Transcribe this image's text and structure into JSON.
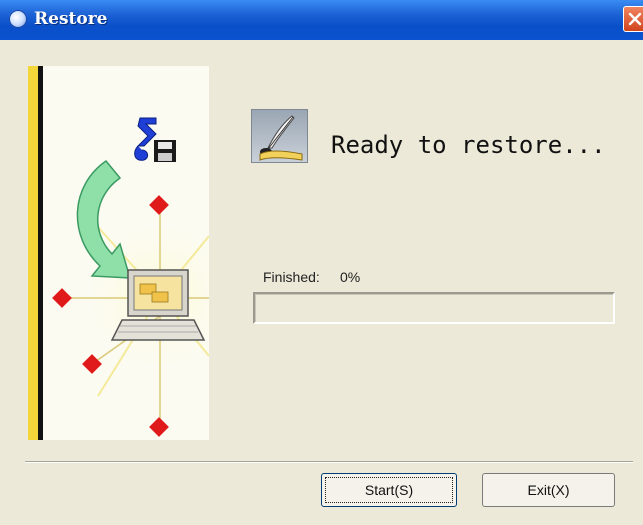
{
  "window": {
    "title": "Restore",
    "icon": "restore-app-icon",
    "close_icon": "close-icon"
  },
  "main": {
    "status_icon": "quill-scroll-icon",
    "status_text": "Ready to restore...",
    "progress": {
      "label": "Finished:",
      "value_text": "0%",
      "percent": 0
    }
  },
  "buttons": {
    "start_label": "Start(S)",
    "exit_label": "Exit(X)"
  },
  "colors": {
    "titlebar": "#0a4fc8",
    "window_bg": "#ece9d8",
    "accent_diamond": "#e01a1a",
    "art_arrow": "#7fd6a0"
  }
}
